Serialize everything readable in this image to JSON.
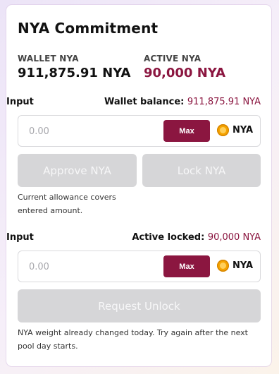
{
  "title": "NYA Commitment",
  "wallet": {
    "label": "WALLET NYA",
    "value": "911,875.91 NYA"
  },
  "active": {
    "label": "ACTIVE NYA",
    "value": "90,000 NYA"
  },
  "lock_section": {
    "input_label": "Input",
    "balance_label": "Wallet balance:",
    "balance_value": "911,875.91 NYA",
    "placeholder": "0.00",
    "max_label": "Max",
    "token_label": "NYA",
    "approve_label": "Approve NYA",
    "lock_label": "Lock NYA",
    "note": "Current allowance covers entered amount."
  },
  "unlock_section": {
    "input_label": "Input",
    "locked_label": "Active locked:",
    "locked_value": "90,000 NYA",
    "placeholder": "0.00",
    "max_label": "Max",
    "token_label": "NYA",
    "request_label": "Request Unlock",
    "note": "NYA weight already changed today. Try again after the next pool day starts."
  },
  "colors": {
    "accent": "#8b1640",
    "disabled": "#d6d6d8"
  },
  "icons": {
    "token": "nya-coin-icon"
  }
}
